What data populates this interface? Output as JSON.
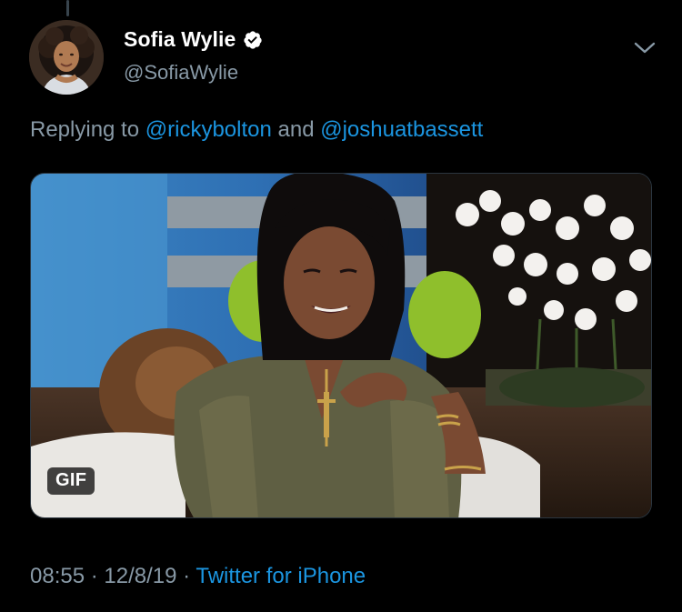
{
  "tweet": {
    "display_name": "Sofia Wylie",
    "handle": "@SofiaWylie",
    "verified": true,
    "reply_prefix": "Replying to ",
    "mention_1": "@rickybolton",
    "reply_join": " and ",
    "mention_2": "@joshuatbassett",
    "media_badge": "GIF",
    "time": "08:55",
    "dot_1": " · ",
    "date": "12/8/19",
    "dot_2": " · ",
    "source": "Twitter for iPhone"
  },
  "icons": {
    "verified": "verified-badge-icon",
    "menu": "chevron-down-icon"
  },
  "colors": {
    "background": "#000000",
    "primary_text": "#ffffff",
    "secondary_text": "#8899a6",
    "link": "#1b95e0"
  }
}
